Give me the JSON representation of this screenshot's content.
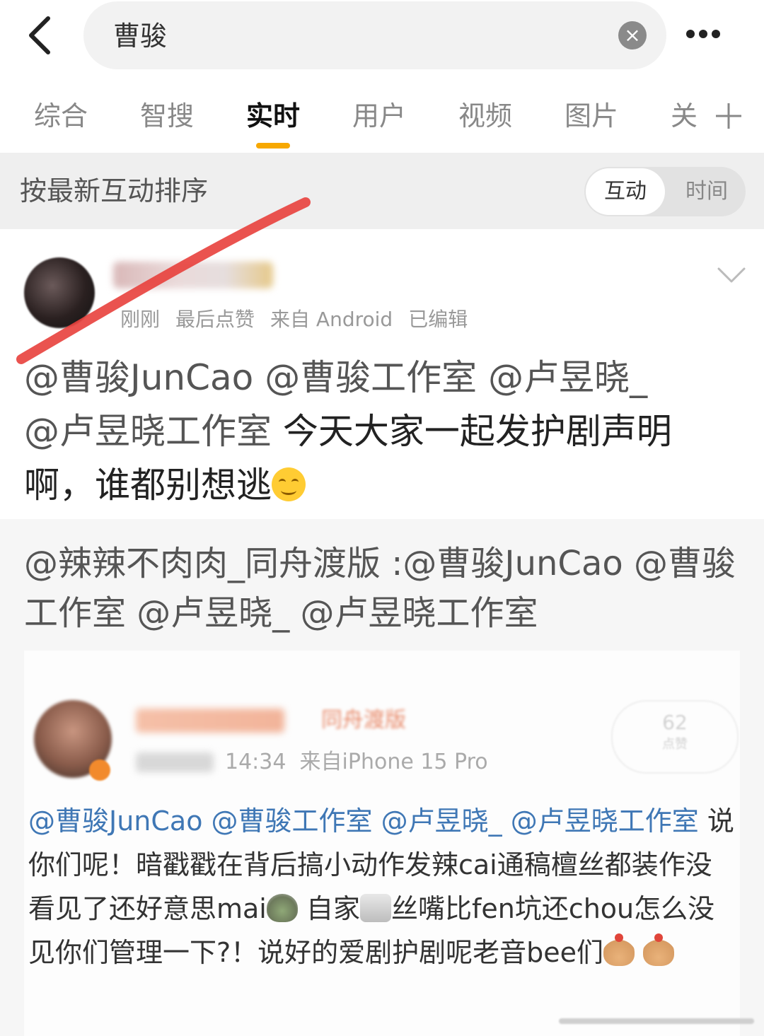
{
  "search": {
    "query": "曹骏"
  },
  "tabs": [
    {
      "label": "综合",
      "active": false
    },
    {
      "label": "智搜",
      "active": false
    },
    {
      "label": "实时",
      "active": true
    },
    {
      "label": "用户",
      "active": false
    },
    {
      "label": "视频",
      "active": false
    },
    {
      "label": "图片",
      "active": false
    },
    {
      "label": "关",
      "active": false
    }
  ],
  "sort": {
    "label": "按最新互动排序",
    "option_interaction": "互动",
    "option_time": "时间",
    "selected": "互动"
  },
  "post": {
    "meta": {
      "time": "刚刚",
      "last_like": "最后点赞",
      "source": "来自 Android",
      "edited": "已编辑"
    },
    "mention_1": "@曹骏JunCao",
    "mention_2": "@曹骏工作室",
    "mention_3": "@卢昱晓_",
    "mention_4": "@卢昱晓工作室",
    "text_1": "今天大家一起发护剧声明",
    "text_2": "啊，谁都别想逃",
    "emoji": "smile-icon"
  },
  "repost": {
    "text": "@辣辣不肉肉_同舟渡版 :@曹骏JunCao @曹骏工作室 @卢昱晓_ @卢昱晓工作室",
    "inner": {
      "name_visible": "同舟渡版",
      "time": "14:34",
      "source": "来自iPhone 15 Pro",
      "like_count": "62",
      "like_label": "点赞",
      "mention_1": "@曹骏JunCao",
      "mention_2": "@曹骏工作室",
      "mention_3": "@卢昱晓_",
      "mention_4": "@卢昱晓工作室",
      "text_1": "说你们呢！暗戳戳在背后搞小动作发辣cai通稿檀丝都装作没看见了还好意思mai",
      "text_2": "自家",
      "text_3": "丝嘴比fen坑还chou怎么没见你们管理一下?！说好的爱剧护剧呢老音bee们"
    }
  },
  "colors": {
    "accent": "#f7a800",
    "mention_blue": "#3f77b5",
    "annotation_red": "#e8403c"
  }
}
